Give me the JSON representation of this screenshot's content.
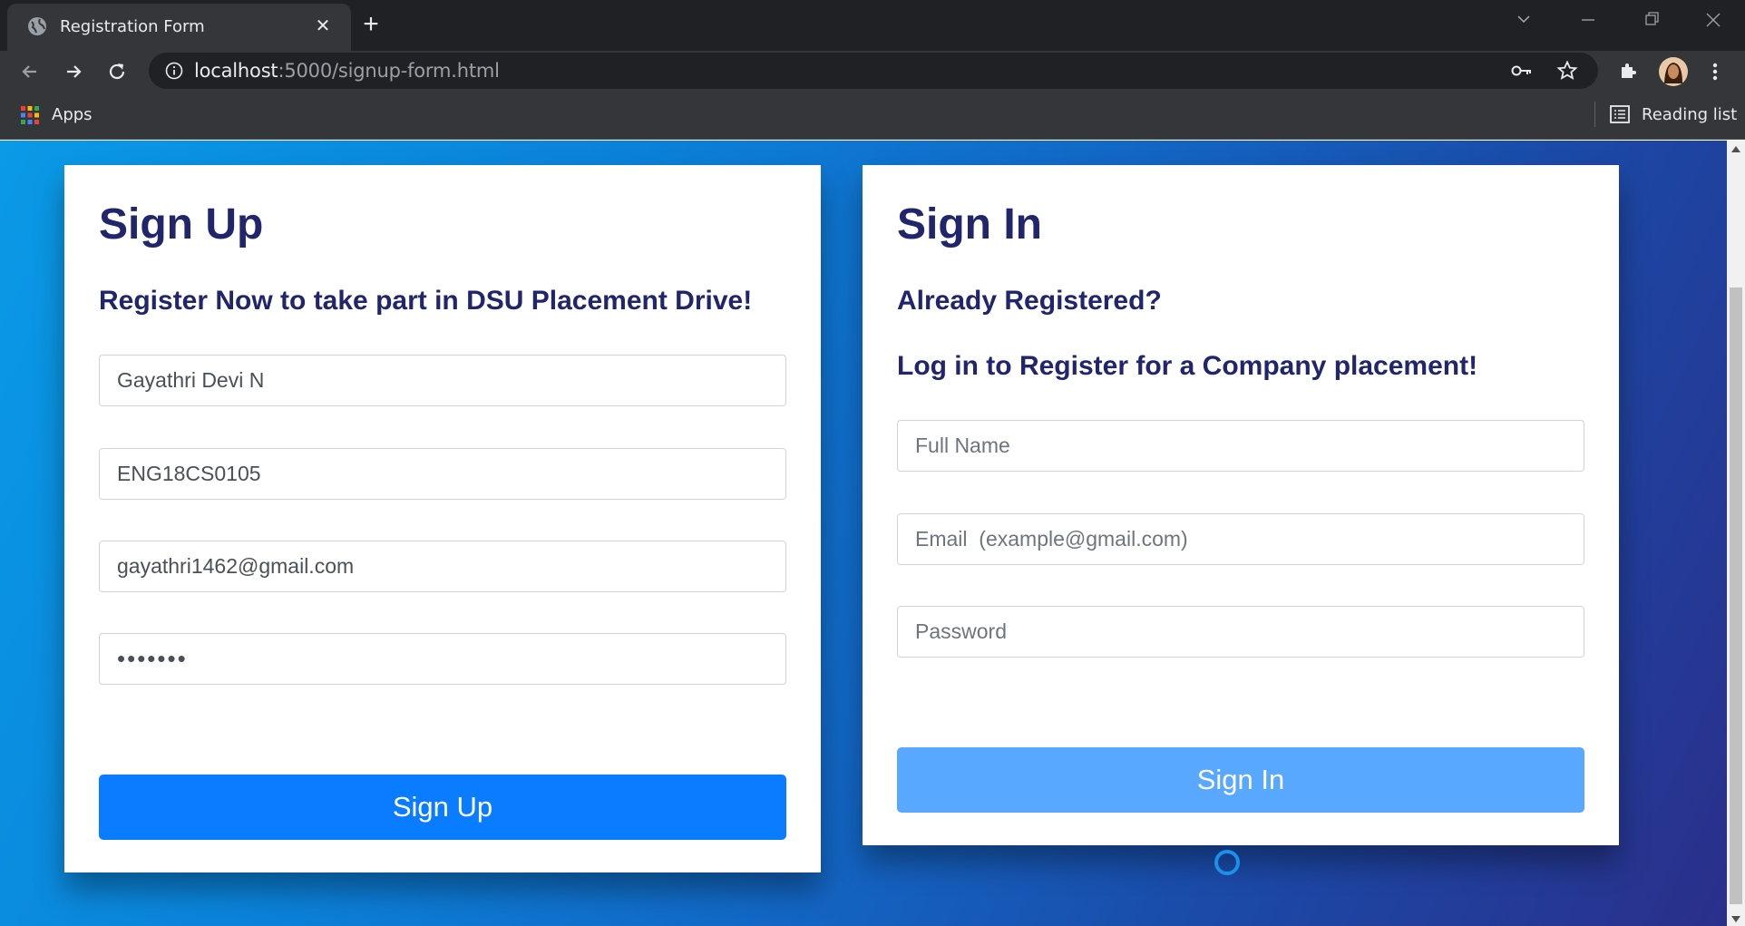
{
  "browser": {
    "tab_title": "Registration Form",
    "url_host": "localhost",
    "url_rest": ":5000/signup-form.html",
    "bookmarks_apps": "Apps",
    "reading_list": "Reading list"
  },
  "signup": {
    "title": "Sign Up",
    "subtitle": "Register Now to take part in DSU Placement Drive!",
    "name_value": "Gayathri Devi N",
    "usn_value": "ENG18CS0105",
    "email_value": "gayathri1462@gmail.com",
    "password_value": "1234567",
    "button_label": "Sign Up"
  },
  "signin": {
    "title": "Sign In",
    "subtitle1": "Already Registered?",
    "subtitle2": "Log in to Register for a Company placement!",
    "name_placeholder": "Full Name",
    "email_placeholder": "Email  (example@gmail.com)",
    "password_placeholder": "Password",
    "button_label": "Sign In"
  },
  "colors": {
    "heading": "#21256b",
    "primary_button": "#0a7cff",
    "signin_button": "#58a8ff"
  }
}
